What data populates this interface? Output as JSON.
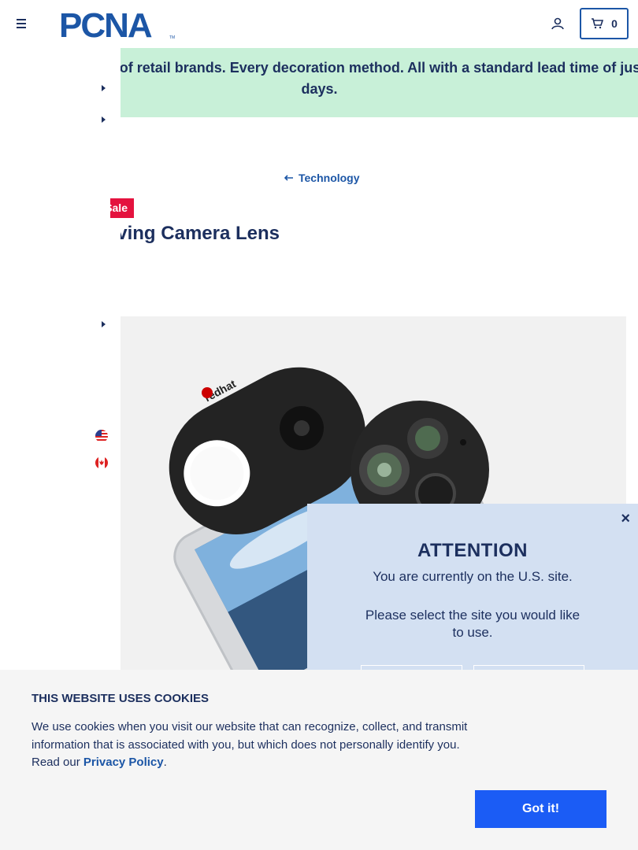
{
  "header": {
    "logo_text": "PCNA",
    "logo_tm": "TM",
    "cart_count": "0"
  },
  "promo": {
    "text": "Thousands of products. Dozens of retail brands. Every decoration method. All with a standard lead time of just five business days."
  },
  "breadcrumb": {
    "label": "Technology"
  },
  "product": {
    "badge": "Sale",
    "title": "Lens Saving Camera Lens",
    "image_logo_text": "redhat"
  },
  "attention": {
    "title": "ATTENTION",
    "line1": "You are currently on the U.S. site.",
    "line2": "Please select the site you would like to use.",
    "close": "×"
  },
  "cookies": {
    "title": "THIS WEBSITE USES COOKIES",
    "text_before": "We use cookies when you visit our website that can recognize, collect, and transmit information that is associated with you, but which does not personally identify you. Read our ",
    "link": "Privacy Policy",
    "text_after": ".",
    "button": "Got it!"
  },
  "colors": {
    "navy": "#1c2f5e",
    "brand_blue": "#1c56a6",
    "promo_green": "#c8f0d8",
    "sale_red": "#e4123e",
    "modal_blue": "#d3e0f2",
    "button_blue": "#1b5cf5"
  }
}
